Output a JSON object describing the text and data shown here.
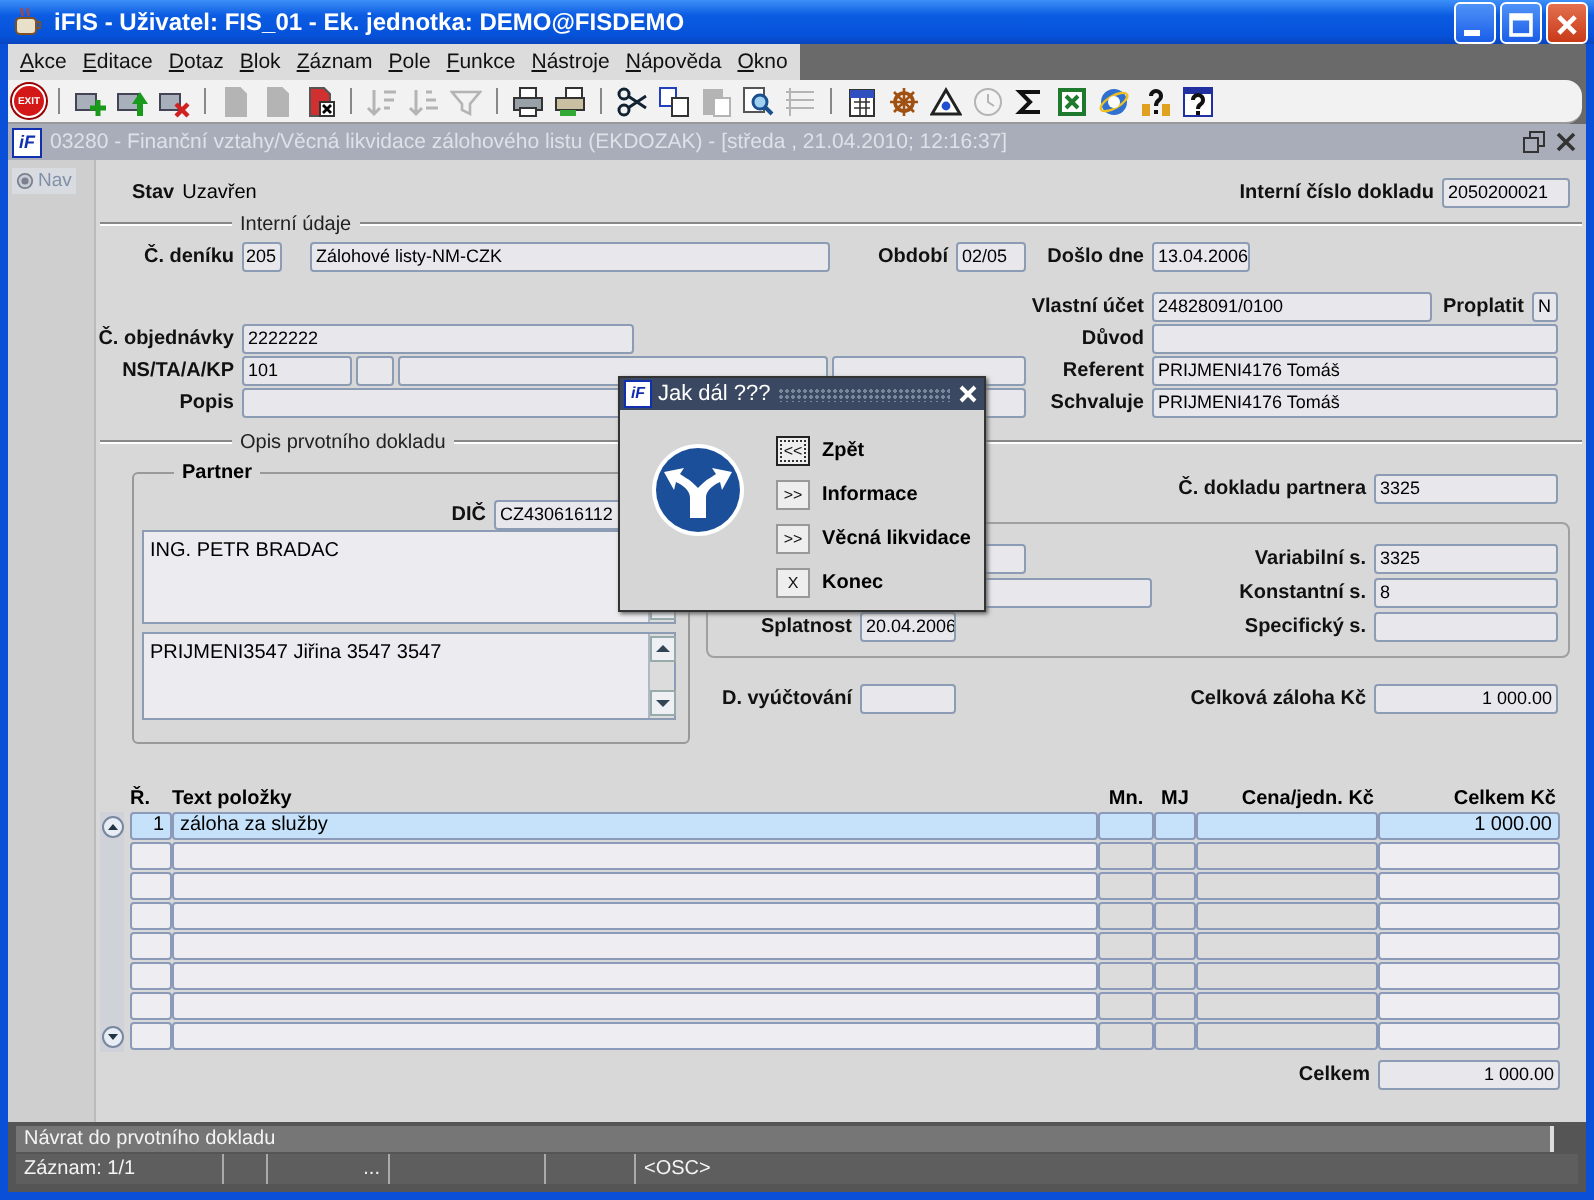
{
  "window": {
    "title": "iFIS - Uživatel: FIS_01 - Ek. jednotka: DEMO@FISDEMO"
  },
  "menu": [
    "Akce",
    "Editace",
    "Dotaz",
    "Blok",
    "Záznam",
    "Pole",
    "Funkce",
    "Nástroje",
    "Nápověda",
    "Okno"
  ],
  "toolbar": [
    {
      "kind": "exit",
      "label": "EXIT",
      "disabled": false
    },
    {
      "kind": "separator"
    },
    {
      "kind": "add",
      "disabled": false
    },
    {
      "kind": "save",
      "disabled": false
    },
    {
      "kind": "delete",
      "disabled": false
    },
    {
      "kind": "separator"
    },
    {
      "kind": "query",
      "disabled": true
    },
    {
      "kind": "query-run",
      "disabled": true
    },
    {
      "kind": "query-cancel",
      "disabled": false
    },
    {
      "kind": "separator"
    },
    {
      "kind": "sort-up",
      "disabled": true
    },
    {
      "kind": "sort-down",
      "disabled": true
    },
    {
      "kind": "filter",
      "disabled": true
    },
    {
      "kind": "separator"
    },
    {
      "kind": "print",
      "disabled": false
    },
    {
      "kind": "print-setup",
      "disabled": false
    },
    {
      "kind": "separator"
    },
    {
      "kind": "cut",
      "disabled": false
    },
    {
      "kind": "copy",
      "disabled": false
    },
    {
      "kind": "paste",
      "disabled": true
    },
    {
      "kind": "find",
      "disabled": false
    },
    {
      "kind": "list",
      "disabled": true
    },
    {
      "kind": "separator"
    },
    {
      "kind": "calendar",
      "disabled": false
    },
    {
      "kind": "wheel",
      "disabled": false
    },
    {
      "kind": "triangle",
      "disabled": false
    },
    {
      "kind": "clock",
      "disabled": true
    },
    {
      "kind": "sum",
      "disabled": false
    },
    {
      "kind": "spreadsheet",
      "disabled": false
    },
    {
      "kind": "globe",
      "disabled": false
    },
    {
      "kind": "help-wizard",
      "disabled": false
    },
    {
      "kind": "help",
      "disabled": false
    }
  ],
  "form_window": {
    "logo": "iF",
    "title": "03280 - Finanční vztahy/Věcná likvidace zálohového listu (EKDOZAK) - [středa , 21.04.2010; 12:16:37]",
    "active": false
  },
  "nav_button": "Nav",
  "header": {
    "stav": {
      "label": "Stav",
      "value": "Uzavřen"
    },
    "interni_cislo": {
      "label": "Interní číslo dokladu",
      "value": "2050200021"
    }
  },
  "interni_udaje": {
    "title": "Interní údaje",
    "cislo_deniku": {
      "label": "Č. deníku",
      "value": "205",
      "name": "Zálohové listy-NM-CZK"
    },
    "obdobi": {
      "label": "Období",
      "value": "02/05"
    },
    "doslo_dne": {
      "label": "Došlo dne",
      "value": "13.04.2006"
    },
    "vlastni_ucet": {
      "label": "Vlastní účet",
      "value": "24828091/0100"
    },
    "proplatit": {
      "label": "Proplatit",
      "value": "N"
    },
    "cislo_objednavky": {
      "label": "Č. objednávky",
      "value": "2222222"
    },
    "duvod": {
      "label": "Důvod"
    },
    "ns_ta_a_kp": {
      "label": "NS/TA/A/KP",
      "value": "101"
    },
    "referent": {
      "label": "Referent",
      "value": "PRIJMENI4176 Tomáš"
    },
    "popis": {
      "label": "Popis"
    },
    "schvaluje": {
      "label": "Schvaluje",
      "value": "PRIJMENI4176 Tomáš"
    }
  },
  "opis": {
    "title": "Opis prvotního dokladu",
    "partner": {
      "title": "Partner",
      "dic": {
        "label": "DIČ",
        "value": "CZ430616112"
      },
      "name": "ING. PETR BRADAC",
      "contact": "PRIJMENI3547 Jiřina 3547 3547"
    },
    "cislo_dokladu_partnera": {
      "label": "Č. dokladu partnera",
      "value": "3325"
    },
    "variabilni": {
      "label": "Variabilní s.",
      "value": "3325"
    },
    "konstantni": {
      "label": "Konstantní s.",
      "value": "8"
    },
    "splatnost": {
      "label": "Splatnost",
      "value": "20.04.2006"
    },
    "specificky": {
      "label": "Specifický s."
    },
    "d_vyuctovani": {
      "label": "D. vyúčtování"
    },
    "celkova_zaloha": {
      "label": "Celková záloha Kč",
      "value": "1 000.00"
    }
  },
  "items": {
    "columns": [
      "Ř.",
      "Text položky",
      "Mn.",
      "MJ",
      "Cena/jedn. Kč",
      "Celkem Kč"
    ],
    "rows": [
      {
        "nr": "1",
        "text": "záloha za služby",
        "celkem": "1 000.00",
        "selected": true
      },
      {
        "selected": false
      },
      {
        "selected": false
      },
      {
        "selected": false
      },
      {
        "selected": false
      },
      {
        "selected": false
      },
      {
        "selected": false
      },
      {
        "selected": false
      }
    ]
  },
  "total": {
    "label": "Celkem",
    "value": "1 000.00"
  },
  "status_bar": {
    "message": "Návrat do prvotního dokladu",
    "record": "Záznam: 1/1",
    "segment_3": "...",
    "mode": "<OSC>"
  },
  "dialog": {
    "logo": "iF",
    "title": "Jak dál ???",
    "options": [
      {
        "key": "<<",
        "label": "Zpět",
        "focused": true
      },
      {
        "key": ">>",
        "label": "Informace",
        "focused": false
      },
      {
        "key": ">>",
        "label": "Věcná likvidace",
        "focused": false
      },
      {
        "key": "X",
        "label": "Konec",
        "focused": false
      }
    ]
  }
}
